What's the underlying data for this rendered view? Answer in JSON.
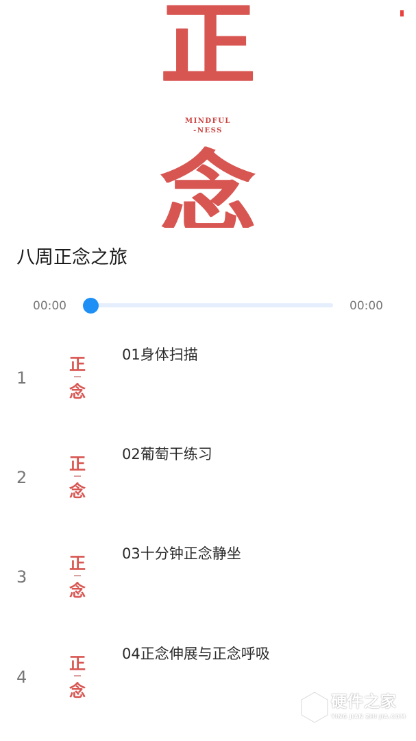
{
  "cover": {
    "char_top": "正",
    "char_bottom": "念",
    "subtitle_line1": "MINDFUL",
    "subtitle_line2": "-NESS",
    "accent_color": "#d85652"
  },
  "album": {
    "title": "八周正念之旅"
  },
  "player": {
    "current_time": "00:00",
    "total_time": "00:00",
    "progress": 0,
    "accent_color": "#1890ff"
  },
  "tracks": [
    {
      "number": "1",
      "title": "01身体扫描",
      "thumb_top": "正",
      "thumb_bottom": "念"
    },
    {
      "number": "2",
      "title": "02葡萄干练习",
      "thumb_top": "正",
      "thumb_bottom": "念"
    },
    {
      "number": "3",
      "title": "03十分钟正念静坐",
      "thumb_top": "正",
      "thumb_bottom": "念"
    },
    {
      "number": "4",
      "title": "04正念伸展与正念呼吸",
      "thumb_top": "正",
      "thumb_bottom": "念"
    }
  ],
  "watermark": {
    "main": "硬件之家",
    "sub": "YING JIAN ZHI JIA.COM",
    "icon": "hexagon-logo-icon"
  }
}
